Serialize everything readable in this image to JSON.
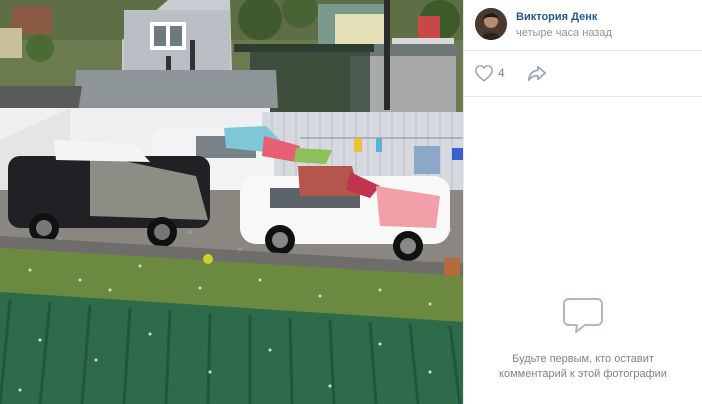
{
  "photo": {
    "description_name": "hail-scene-photo"
  },
  "author": {
    "name": "Виктория Денк",
    "time": "четыре часа назад"
  },
  "actions": {
    "likes": "4",
    "like_icon": "heart-icon",
    "share_icon": "share-icon"
  },
  "comments": {
    "icon": "comment-bubble-icon",
    "empty_line1": "Будьте первым, кто оставит",
    "empty_line2": "комментарий к этой фотографии"
  },
  "colors": {
    "link": "#2a5885",
    "muted": "#939393",
    "icon": "#99a2ad",
    "divider": "#e7e8ec"
  }
}
